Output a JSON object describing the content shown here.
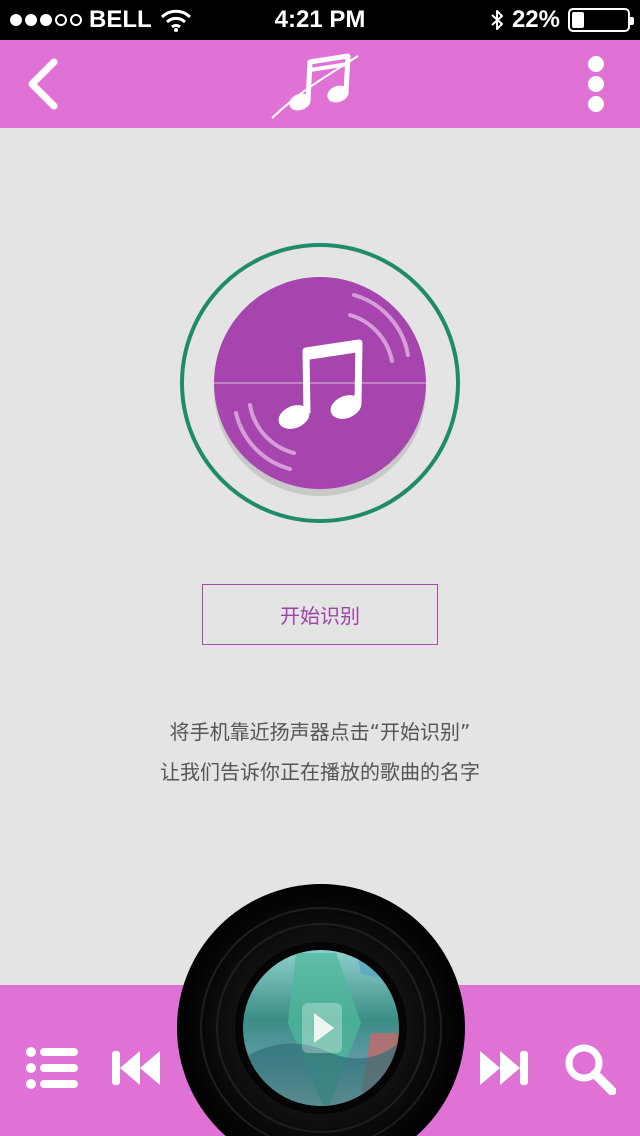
{
  "status_bar": {
    "signal_filled": 3,
    "signal_total": 5,
    "carrier": "BELL",
    "time": "4:21 PM",
    "battery_percent": "22%",
    "battery_level": 0.22,
    "icons": [
      "wifi-icon",
      "bluetooth-icon",
      "battery-icon"
    ]
  },
  "top_bar": {
    "background": "#e071d5",
    "icons": [
      "back-chevron-icon",
      "music-note-logo-icon",
      "more-vertical-icon"
    ]
  },
  "recognizer": {
    "ring_color": "#1e8c6a",
    "disc_color": "#a645ad",
    "icon": "music-note-icon"
  },
  "main": {
    "start_button_label": "开始识别",
    "instruction_line1": "将手机靠近扬声器点击“开始识别”",
    "instruction_line2": "让我们告诉你正在播放的歌曲的名字"
  },
  "bottom_bar": {
    "background": "#e071d5",
    "icons": [
      "playlist-icon",
      "previous-track-icon",
      "album-art-play-icon",
      "next-track-icon",
      "search-icon"
    ]
  }
}
